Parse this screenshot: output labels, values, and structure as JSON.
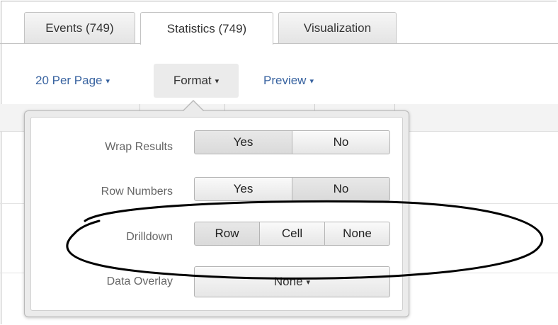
{
  "tabs": [
    {
      "label": "Events (749)",
      "active": false
    },
    {
      "label": "Statistics (749)",
      "active": true
    },
    {
      "label": "Visualization",
      "active": false
    }
  ],
  "toolbar": {
    "per_page": "20 Per Page",
    "format": "Format",
    "preview": "Preview",
    "caret": "▾"
  },
  "format_menu": {
    "wrap_results": {
      "label": "Wrap Results",
      "options": [
        "Yes",
        "No"
      ]
    },
    "row_numbers": {
      "label": "Row Numbers",
      "options": [
        "Yes",
        "No"
      ]
    },
    "drilldown": {
      "label": "Drilldown",
      "options": [
        "Row",
        "Cell",
        "None"
      ]
    },
    "data_overlay": {
      "label": "Data Overlay",
      "value": "None"
    }
  },
  "colors": {
    "link": "#3863a0",
    "annotation": "#000000"
  }
}
